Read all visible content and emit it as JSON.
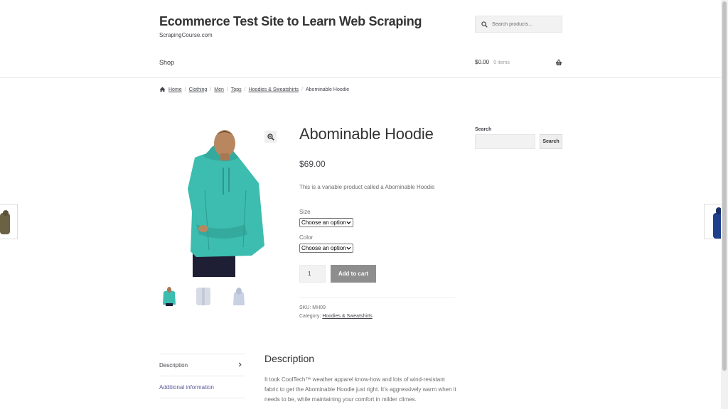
{
  "header": {
    "site_title": "Ecommerce Test Site to Learn Web Scraping",
    "site_description": "ScrapingCourse.com",
    "search_placeholder": "Search products…",
    "nav_shop": "Shop",
    "cart_amount": "$0.00",
    "cart_count": "0 items"
  },
  "breadcrumb": {
    "items": [
      "Home",
      "Clothing",
      "Men",
      "Tops",
      "Hoodies & Sweatshirts"
    ],
    "current": "Abominable Hoodie"
  },
  "product": {
    "title": "Abominable Hoodie",
    "price": "$69.00",
    "short_description": "This is a variable product called a Abominable Hoodie",
    "size_label": "Size",
    "size_selected": "Choose an option",
    "color_label": "Color",
    "color_selected": "Choose an option",
    "quantity": "1",
    "add_to_cart_label": "Add to cart",
    "sku_label": "SKU:",
    "sku_value": "MH09",
    "category_label": "Category:",
    "category_value": "Hoodies & Sweatshirts",
    "main_image_color": "#3cbdb0"
  },
  "sidebar": {
    "search_heading": "Search",
    "search_button": "Search"
  },
  "tabs": {
    "items": [
      {
        "label": "Description"
      },
      {
        "label": "Additional information"
      }
    ]
  },
  "description": {
    "heading": "Description",
    "body": "It took CoolTech™ weather apparel know-how and lots of wind-resistant fabric to get the Abominable Hoodie just right. It’s aggressively warm when it needs to be, while maintaining your comfort in milder climes."
  },
  "colors": {
    "button_bg": "#8e8e8e",
    "link_inactive": "#5b5b9b",
    "hoodie_teal": "#3cbdb0"
  },
  "icons": {
    "search": "search-icon",
    "basket": "basket-icon",
    "home": "home-icon",
    "zoom": "zoom-icon",
    "tab_arrow": "chevron-right-icon"
  }
}
